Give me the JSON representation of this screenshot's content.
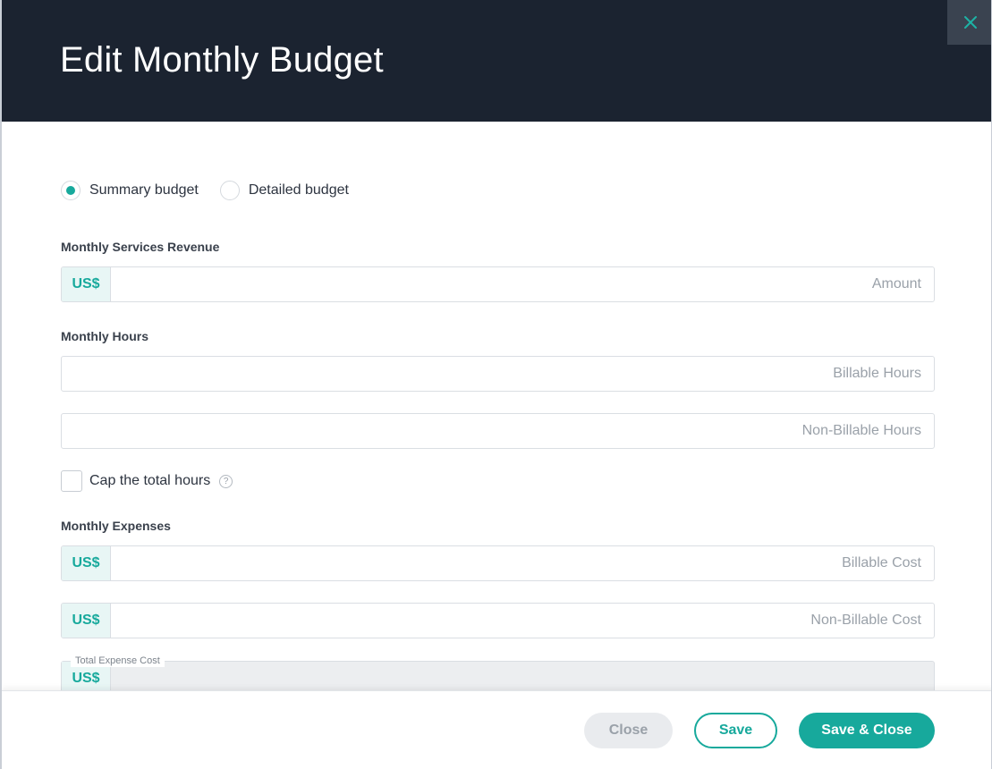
{
  "modal": {
    "title": "Edit Monthly Budget"
  },
  "budget_type": {
    "options": [
      {
        "label": "Summary budget",
        "selected": true
      },
      {
        "label": "Detailed budget",
        "selected": false
      }
    ]
  },
  "revenue": {
    "section_label": "Monthly Services Revenue",
    "currency": "US$",
    "amount_placeholder": "Amount"
  },
  "hours": {
    "section_label": "Monthly Hours",
    "billable_placeholder": "Billable Hours",
    "non_billable_placeholder": "Non-Billable Hours",
    "cap_label": "Cap the total hours",
    "help_glyph": "?"
  },
  "expenses": {
    "section_label": "Monthly Expenses",
    "currency": "US$",
    "billable_cost_placeholder": "Billable Cost",
    "non_billable_cost_placeholder": "Non-Billable Cost",
    "total_label": "Total Expense Cost"
  },
  "footer": {
    "close_label": "Close",
    "save_label": "Save",
    "save_close_label": "Save & Close"
  },
  "colors": {
    "header_bg": "#1b2330",
    "accent": "#17a99c",
    "close_tab_bg": "#3a4350"
  }
}
